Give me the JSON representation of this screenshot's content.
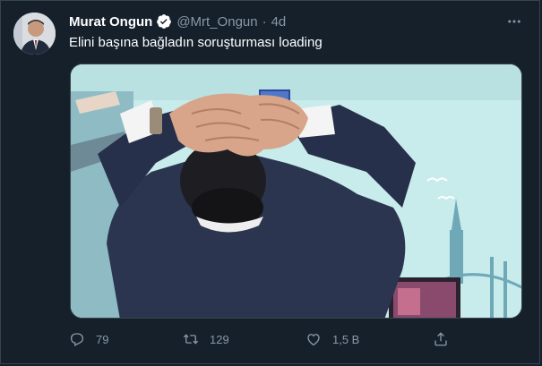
{
  "tweet": {
    "author_name": "Murat Ongun",
    "author_handle": "@Mrt_Ongun",
    "separator": "·",
    "timestamp": "4d",
    "text": "Elini başına bağladın soruşturması loading",
    "verified": true
  },
  "actions": {
    "replies": "79",
    "retweets": "129",
    "likes": "1,5 B"
  },
  "icons": {
    "verified": "verified-badge-icon",
    "more": "more-options-icon",
    "reply": "reply-icon",
    "retweet": "retweet-icon",
    "like": "heart-icon",
    "share": "share-icon"
  },
  "colors": {
    "background": "#15202b",
    "border": "#38444d",
    "secondary_text": "#8899a6",
    "verified": "#ffffff"
  }
}
